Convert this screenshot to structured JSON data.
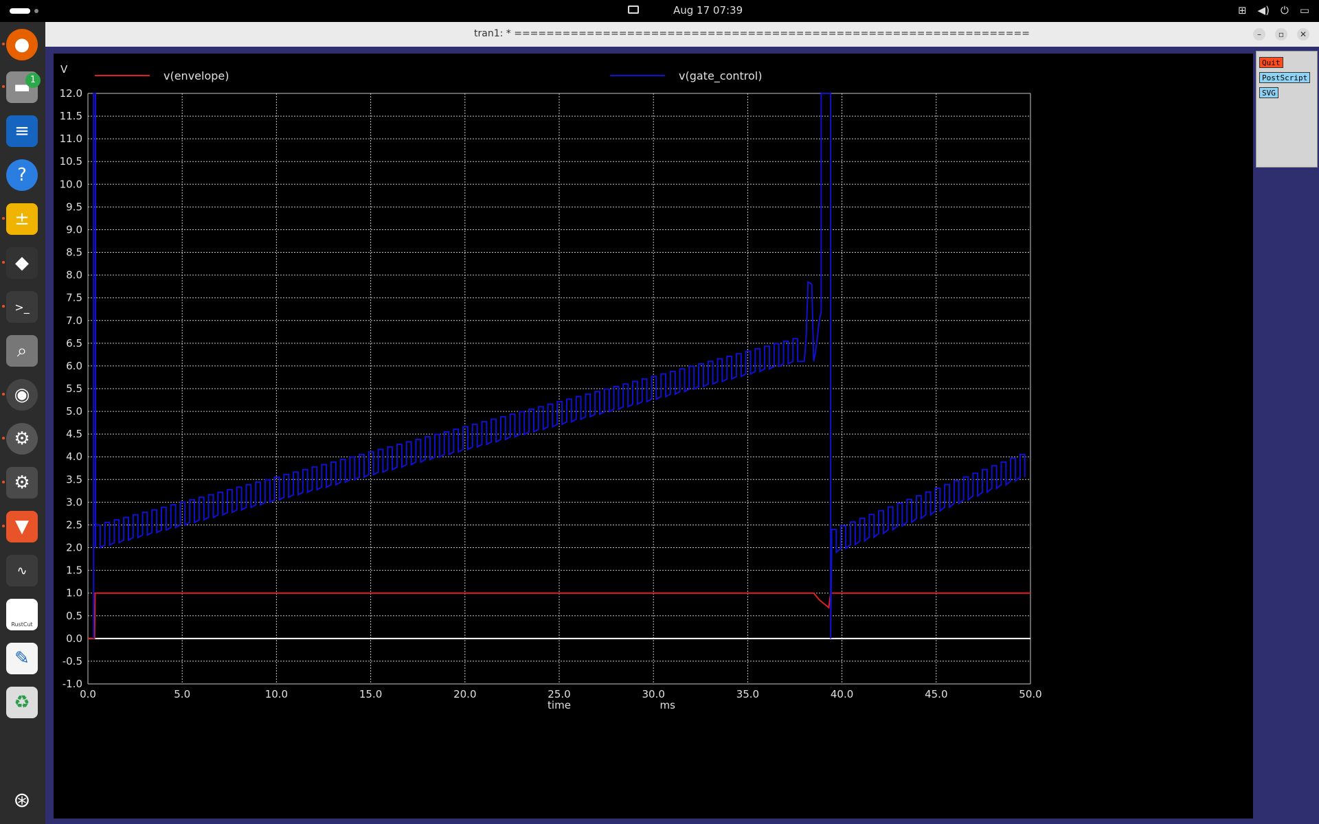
{
  "topbar": {
    "clock": "Aug 17  07:39",
    "tray_icons": [
      "network-icon",
      "volume-icon",
      "power-icon",
      "battery-icon"
    ]
  },
  "dock": {
    "items": [
      {
        "name": "firefox",
        "icon": "firefox-icon",
        "running": true
      },
      {
        "name": "files",
        "icon": "folder-icon",
        "running": true,
        "badge": "1"
      },
      {
        "name": "writer",
        "icon": "document-icon",
        "running": false
      },
      {
        "name": "help",
        "icon": "help-icon",
        "running": false
      },
      {
        "name": "calculator",
        "icon": "calculator-icon",
        "running": true
      },
      {
        "name": "inkscape",
        "icon": "inkscape-icon",
        "running": true
      },
      {
        "name": "terminal",
        "icon": "terminal-icon",
        "running": true
      },
      {
        "name": "search",
        "icon": "magnifier-icon",
        "running": false
      },
      {
        "name": "speaker",
        "icon": "speaker-icon",
        "running": true
      },
      {
        "name": "settings",
        "icon": "gear-icon",
        "running": true
      },
      {
        "name": "settings-2",
        "icon": "gear-icon",
        "running": true,
        "active": true
      },
      {
        "name": "brave",
        "icon": "brave-icon",
        "running": true
      },
      {
        "name": "system-monitor",
        "icon": "monitor-icon",
        "running": false
      },
      {
        "name": "rustcut",
        "icon": "rustcut-icon",
        "label": "RustCut",
        "running": false
      },
      {
        "name": "text-editor",
        "icon": "text-editor-icon",
        "running": false
      },
      {
        "name": "trash",
        "icon": "trash-icon",
        "running": false
      },
      {
        "name": "show-apps",
        "icon": "ubuntu-icon",
        "running": false
      }
    ]
  },
  "window": {
    "title": "tran1: * ================================================================",
    "controls": {
      "minimize": "–",
      "maximize": "▫",
      "close": "✕"
    }
  },
  "side_panel": {
    "quit": "Quit",
    "postscript": "PostScript",
    "svg": "SVG"
  },
  "chart_data": {
    "type": "line",
    "ylabel": "V",
    "xlabel": "time",
    "xunit": "ms",
    "xlim": [
      0,
      50
    ],
    "ylim": [
      -1,
      12
    ],
    "x_ticks": [
      "0.0",
      "5.0",
      "10.0",
      "15.0",
      "20.0",
      "25.0",
      "30.0",
      "35.0",
      "40.0",
      "45.0",
      "50.0"
    ],
    "y_ticks": [
      "12.0",
      "11.5",
      "11.0",
      "10.5",
      "10.0",
      "9.5",
      "9.0",
      "8.5",
      "8.0",
      "7.5",
      "7.0",
      "6.5",
      "6.0",
      "5.5",
      "5.0",
      "4.5",
      "4.0",
      "3.5",
      "3.0",
      "2.5",
      "2.0",
      "1.5",
      "1.0",
      "0.5",
      "0.0",
      "-0.5",
      "-1.0"
    ],
    "grid": true,
    "legend_position": "top",
    "colors": {
      "envelope": "#e02020",
      "gate_control": "#1010d0",
      "zero_line": "#ffffff",
      "grid": "#c8c8c8"
    },
    "series": [
      {
        "name": "v(envelope)",
        "color": "#e02020",
        "points": [
          [
            0,
            0
          ],
          [
            0.35,
            0
          ],
          [
            0.38,
            1.0
          ],
          [
            38.5,
            1.0
          ],
          [
            38.8,
            0.85
          ],
          [
            39.3,
            0.68
          ],
          [
            39.4,
            1.0
          ],
          [
            50,
            1.0
          ]
        ]
      },
      {
        "name": "v(gate_control)",
        "color": "#1010d0",
        "segments": [
          {
            "type": "point",
            "x": 0.3,
            "y": 0.0
          },
          {
            "type": "spike",
            "x0": 0.3,
            "x1": 0.4,
            "ymax": 12.0
          },
          {
            "type": "sawtooth",
            "t_start": 0.4,
            "t_end": 38.0,
            "period": 0.5,
            "v_low_start": 2.0,
            "v_low_end": 6.1,
            "v_high_start": 2.5,
            "v_high_end": 6.6
          },
          {
            "type": "ramp",
            "points": [
              [
                38.0,
                6.1
              ],
              [
                38.1,
                6.6
              ],
              [
                38.2,
                7.85
              ],
              [
                38.4,
                7.8
              ],
              [
                38.5,
                6.1
              ],
              [
                38.6,
                6.3
              ],
              [
                38.8,
                7.0
              ],
              [
                38.9,
                7.2
              ],
              [
                38.9,
                12.0
              ],
              [
                39.4,
                12.0
              ],
              [
                39.4,
                0.0
              ],
              [
                39.45,
                1.9
              ]
            ]
          },
          {
            "type": "sawtooth",
            "t_start": 39.45,
            "t_end": 50.0,
            "period": 0.5,
            "v_low_start": 1.9,
            "v_low_end": 3.55,
            "v_high_start": 2.4,
            "v_high_end": 4.05
          }
        ]
      }
    ]
  }
}
